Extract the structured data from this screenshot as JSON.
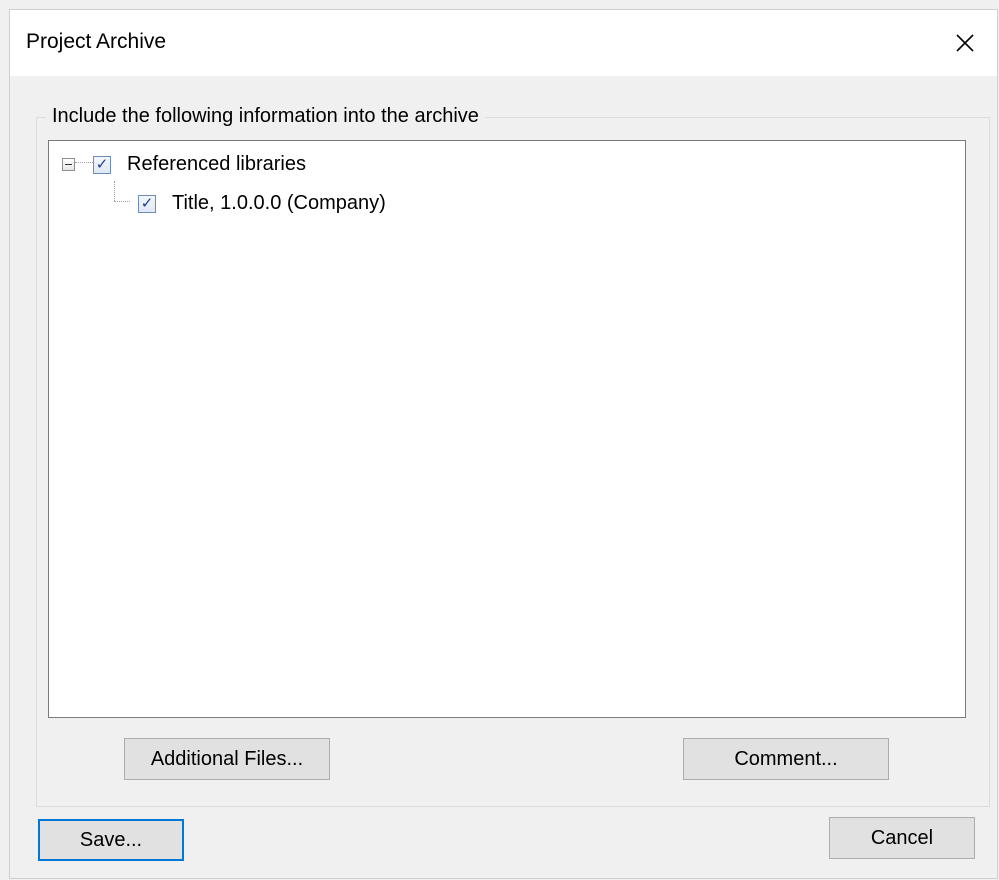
{
  "window": {
    "title": "Project Archive"
  },
  "group": {
    "label": "Include the following information into the archive"
  },
  "tree": {
    "items": [
      {
        "label": "Referenced libraries",
        "checked": true,
        "expanded": true
      },
      {
        "label": "Title, 1.0.0.0 (Company)",
        "checked": true
      }
    ]
  },
  "buttons": {
    "additional_files": "Additional Files...",
    "comment": "Comment...",
    "save": "Save...",
    "cancel": "Cancel"
  },
  "icons": {
    "close": "close-icon",
    "expander": "collapse-minus-icon",
    "checkbox": "checkmark-icon"
  },
  "colors": {
    "default_button_border": "#0078d7",
    "checkbox_border": "#6d8db8"
  }
}
